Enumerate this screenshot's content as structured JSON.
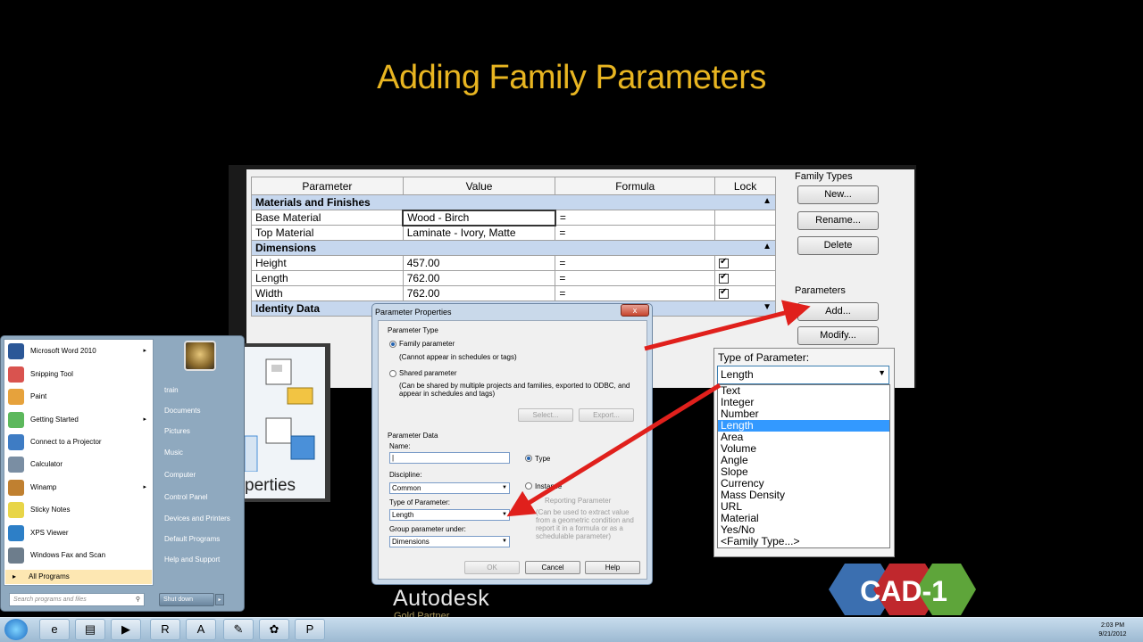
{
  "slide": {
    "title": "Adding Family Parameters"
  },
  "family_types": {
    "columns": [
      "Parameter",
      "Value",
      "Formula",
      "Lock"
    ],
    "groups": [
      {
        "name": "Materials and Finishes",
        "rows": [
          {
            "param": "Base Material",
            "value": "Wood - Birch",
            "formula": "="
          },
          {
            "param": "Top Material",
            "value": "Laminate - Ivory, Matte",
            "formula": "="
          }
        ]
      },
      {
        "name": "Dimensions",
        "rows": [
          {
            "param": "Height",
            "value": "457.00",
            "formula": "="
          },
          {
            "param": "Length",
            "value": "762.00",
            "formula": "="
          },
          {
            "param": "Width",
            "value": "762.00",
            "formula": "="
          }
        ]
      },
      {
        "name": "Identity Data",
        "rows": []
      }
    ],
    "family_types_label": "Family Types",
    "new_button": "New...",
    "rename_button": "Rename...",
    "delete_button": "Delete",
    "parameters_label": "Parameters",
    "add_button": "Add...",
    "modify_button": "Modify..."
  },
  "type_dropdown": {
    "label": "Type of Parameter:",
    "selected": "Length",
    "options": [
      "Text",
      "Integer",
      "Number",
      "Length",
      "Area",
      "Volume",
      "Angle",
      "Slope",
      "Currency",
      "Mass Density",
      "URL",
      "Material",
      "Yes/No",
      "<Family Type...>"
    ]
  },
  "param_props": {
    "title": "Parameter Properties",
    "close": "x",
    "parameter_type_label": "Parameter Type",
    "family_parameter": "Family parameter",
    "family_note": "(Cannot appear in schedules or tags)",
    "shared_parameter": "Shared parameter",
    "shared_note_1": "(Can be shared by multiple projects and families, exported to ODBC, and",
    "shared_note_2": "appear in schedules and tags)",
    "select_button": "Select...",
    "export_button": "Export...",
    "parameter_data_label": "Parameter Data",
    "name_label": "Name:",
    "name_value": "|",
    "type_radio": "Type",
    "instance_radio": "Instance",
    "discipline_label": "Discipline:",
    "discipline_value": "Common",
    "reporting_parameter": "Reporting Parameter",
    "reporting_note_1": "(Can be used to extract value",
    "reporting_note_2": "from a geometric condition and",
    "reporting_note_3": "report it in a formula or as a",
    "reporting_note_4": "schedulable parameter)",
    "type_of_param_label": "Type of Parameter:",
    "type_of_param_value": "Length",
    "group_label": "Group parameter under:",
    "group_value": "Dimensions",
    "ok_button": "OK",
    "cancel_button": "Cancel",
    "help_button": "Help"
  },
  "start_menu": {
    "programs": [
      {
        "label": "Microsoft Word 2010",
        "color": "#2b5797",
        "sub": true
      },
      {
        "label": "Snipping Tool",
        "color": "#d9534f",
        "sub": false
      },
      {
        "label": "Paint",
        "color": "#e6a23c",
        "sub": false
      },
      {
        "label": "Getting Started",
        "color": "#5cb85c",
        "sub": true
      },
      {
        "label": "Connect to a Projector",
        "color": "#3e7cc4",
        "sub": false
      },
      {
        "label": "Calculator",
        "color": "#7a8ea3",
        "sub": false
      },
      {
        "label": "Winamp",
        "color": "#c08030",
        "sub": true
      },
      {
        "label": "Sticky Notes",
        "color": "#e8d548",
        "sub": false
      },
      {
        "label": "XPS Viewer",
        "color": "#2d7fc7",
        "sub": false
      },
      {
        "label": "Windows Fax and Scan",
        "color": "#6d7d8c",
        "sub": false
      }
    ],
    "all_programs": "All Programs",
    "search_placeholder": "Search programs and files",
    "right_items": [
      "train",
      "Documents",
      "Pictures",
      "Music",
      "Computer",
      "Control Panel",
      "Devices and Printers",
      "Default Programs",
      "Help and Support"
    ],
    "shutdown": "Shut down"
  },
  "properties_fragment": "perties",
  "branding": {
    "autodesk": "Autodesk",
    "autodesk_sub": "Gold Partner",
    "cad1": "CAD-1"
  },
  "taskbar": {
    "time": "2:03 PM",
    "date": "9/21/2012"
  }
}
